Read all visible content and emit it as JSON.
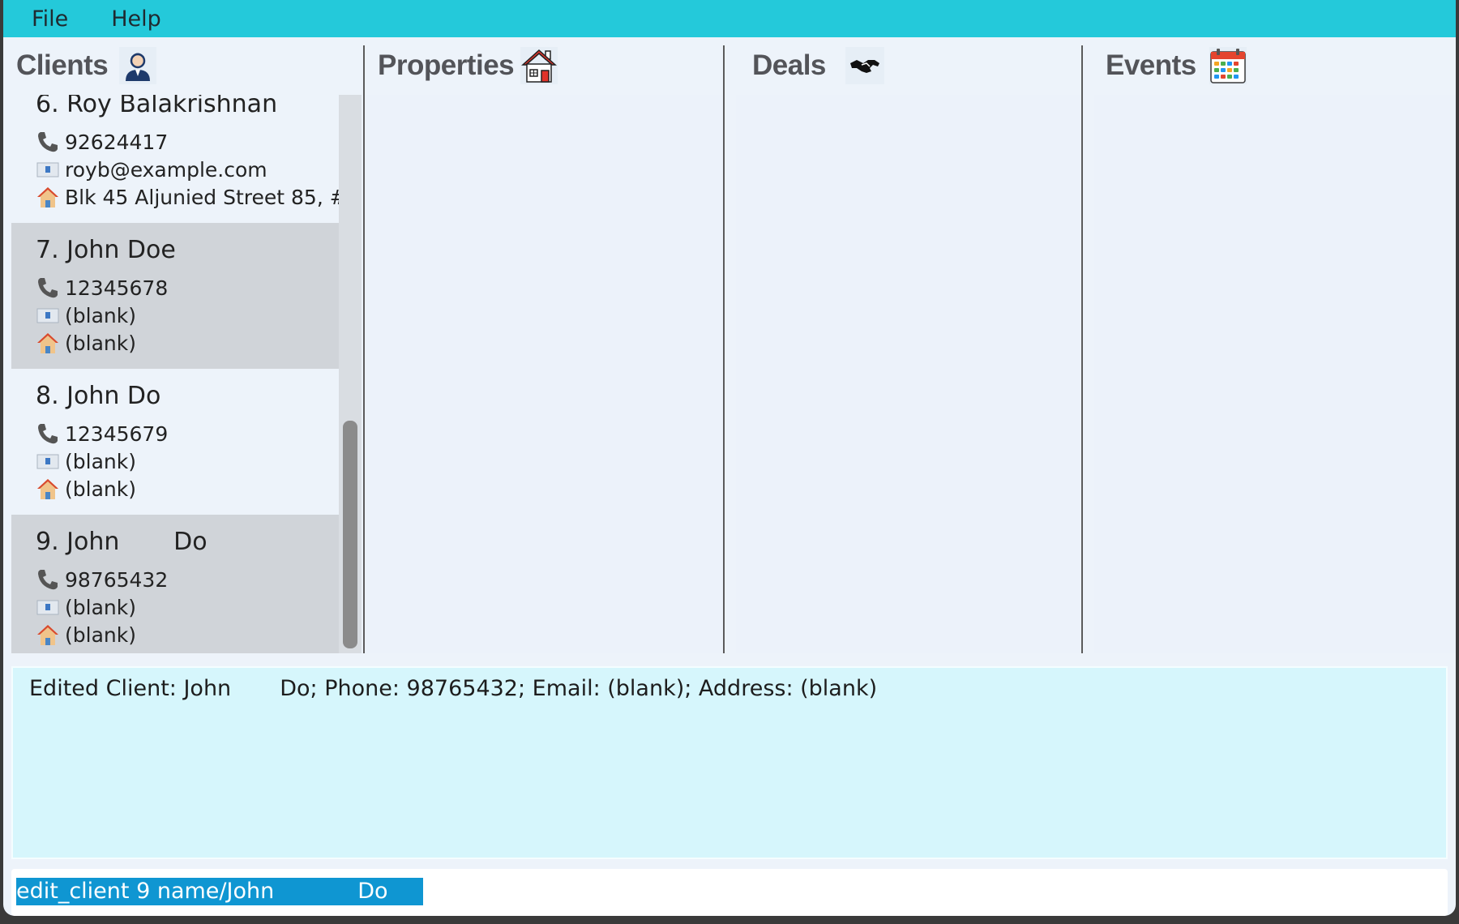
{
  "menu": {
    "file": "File",
    "help": "Help"
  },
  "panels": {
    "clients": {
      "title": "Clients",
      "icon": "client-person-icon"
    },
    "properties": {
      "title": "Properties",
      "icon": "house-icon"
    },
    "deals": {
      "title": "Deals",
      "icon": "handshake-icon"
    },
    "events": {
      "title": "Events",
      "icon": "calendar-icon"
    }
  },
  "clients": [
    {
      "name": "6. Roy Balakrishnan",
      "phone": "92624417",
      "email": "royb@example.com",
      "address": "Blk 45 Aljunied Street 85, #..."
    },
    {
      "name": "7. John Doe",
      "phone": "12345678",
      "email": "(blank)",
      "address": "(blank)"
    },
    {
      "name": "8. John Do",
      "phone": "12345679",
      "email": "(blank)",
      "address": "(blank)"
    },
    {
      "name": "9. John       Do",
      "phone": "98765432",
      "email": "(blank)",
      "address": "(blank)"
    }
  ],
  "result": "Edited Client: John       Do; Phone: 98765432; Email: (blank); Address: (blank)",
  "command": "edit_client 9 name/John            Do",
  "colors": {
    "menubar": "#24c9da",
    "result_bg": "#d6f6fc",
    "selection": "#0f96d2",
    "card_alt": "#d0d4d9"
  }
}
